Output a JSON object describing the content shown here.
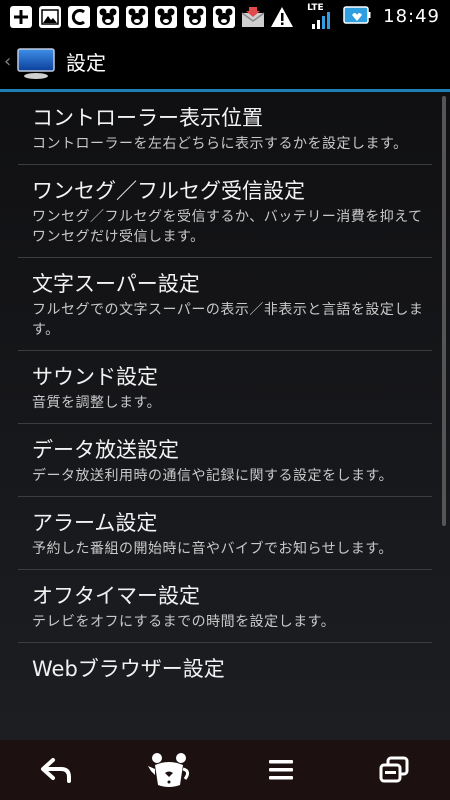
{
  "status_bar": {
    "icons": [
      "add-icon",
      "image-icon",
      "c-app-icon",
      "character-icon",
      "character-icon",
      "character-icon",
      "character-icon",
      "character-icon",
      "mail-download-icon",
      "warning-icon"
    ],
    "network": "LTE",
    "time": "18:49"
  },
  "action_bar": {
    "title": "設定"
  },
  "settings": {
    "items": [
      {
        "title": "コントローラー表示位置",
        "desc": "コントローラーを左右どちらに表示するかを設定します。"
      },
      {
        "title": "ワンセグ／フルセグ受信設定",
        "desc": "ワンセグ／フルセグを受信するか、バッテリー消費を抑えてワンセグだけ受信します。"
      },
      {
        "title": "文字スーパー設定",
        "desc": "フルセグでの文字スーパーの表示／非表示と言語を設定します。"
      },
      {
        "title": "サウンド設定",
        "desc": "音質を調整します。"
      },
      {
        "title": "データ放送設定",
        "desc": "データ放送利用時の通信や記録に関する設定をします。"
      },
      {
        "title": "アラーム設定",
        "desc": "予約した番組の開始時に音やバイブでお知らせします。"
      },
      {
        "title": "オフタイマー設定",
        "desc": "テレビをオフにするまでの時間を設定します。"
      },
      {
        "title": "Webブラウザー設定",
        "desc": ""
      }
    ]
  },
  "colors": {
    "accent": "#1e7fb6",
    "divider": "#3b3d41",
    "nav_bg": "#1c1110"
  }
}
